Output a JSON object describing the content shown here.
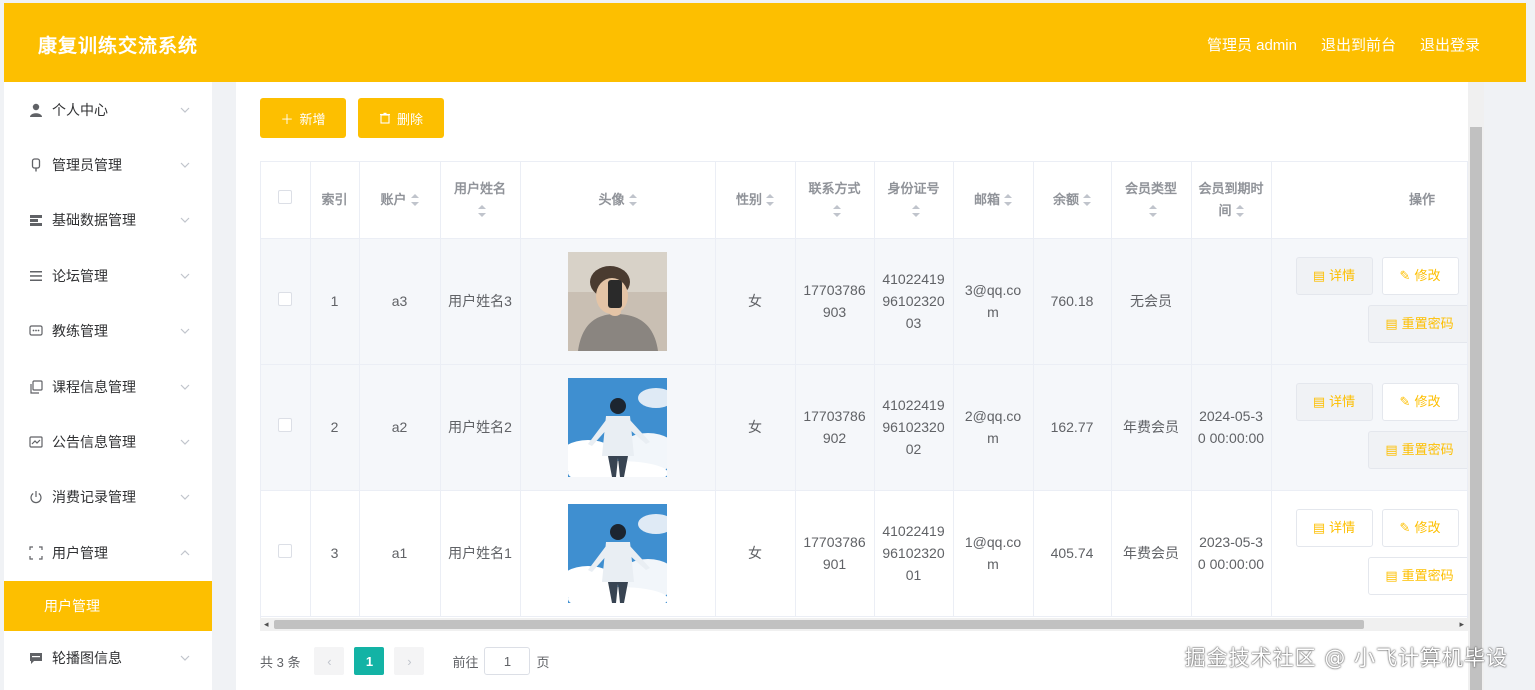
{
  "app": {
    "title": "康复训练交流系统"
  },
  "topnav": {
    "user": "管理员 admin",
    "front": "退出到前台",
    "logout": "退出登录"
  },
  "sidebar": {
    "items": [
      {
        "label": "个人中心",
        "icon": "user-icon",
        "expanded": false
      },
      {
        "label": "管理员管理",
        "icon": "lock-icon",
        "expanded": false
      },
      {
        "label": "基础数据管理",
        "icon": "database-icon",
        "expanded": false
      },
      {
        "label": "论坛管理",
        "icon": "list-icon",
        "expanded": false
      },
      {
        "label": "教练管理",
        "icon": "chat-icon",
        "expanded": false
      },
      {
        "label": "课程信息管理",
        "icon": "copy-icon",
        "expanded": false
      },
      {
        "label": "公告信息管理",
        "icon": "chart-icon",
        "expanded": false
      },
      {
        "label": "消费记录管理",
        "icon": "power-icon",
        "expanded": false
      },
      {
        "label": "用户管理",
        "icon": "fullscreen-icon",
        "expanded": true
      },
      {
        "label": "轮播图信息",
        "icon": "message-icon",
        "expanded": false
      }
    ],
    "active_sub": "用户管理"
  },
  "toolbar": {
    "add_label": "新增",
    "delete_label": "删除"
  },
  "table": {
    "headers": {
      "index": "索引",
      "account": "账户",
      "name": "用户姓名",
      "avatar": "头像",
      "gender": "性别",
      "phone": "联系方式",
      "idcard": "身份证号",
      "email": "邮箱",
      "balance": "余额",
      "member_type": "会员类型",
      "expire": "会员到期时间",
      "ops": "操作"
    },
    "rows": [
      {
        "index": "1",
        "account": "a3",
        "name": "用户姓名3",
        "avatar": "photo-selfie",
        "gender": "女",
        "phone": "17703786903",
        "idcard": "410224199610232003",
        "email": "3@qq.com",
        "balance": "760.18",
        "member_type": "无会员",
        "expire": ""
      },
      {
        "index": "2",
        "account": "a2",
        "name": "用户姓名2",
        "avatar": "photo-sky",
        "gender": "女",
        "phone": "17703786902",
        "idcard": "410224199610232002",
        "email": "2@qq.com",
        "balance": "162.77",
        "member_type": "年费会员",
        "expire": "2024-05-30 00:00:00"
      },
      {
        "index": "3",
        "account": "a1",
        "name": "用户姓名1",
        "avatar": "photo-sky",
        "gender": "女",
        "phone": "17703786901",
        "idcard": "410224199610232001",
        "email": "1@qq.com",
        "balance": "405.74",
        "member_type": "年费会员",
        "expire": "2023-05-30 00:00:00"
      }
    ],
    "actions": {
      "detail": "详情",
      "edit": "修改",
      "reset": "重置密码"
    }
  },
  "pager": {
    "total": "共 3 条",
    "current": "1",
    "goto_prefix": "前往",
    "goto_value": "1",
    "goto_suffix": "页"
  },
  "colors": {
    "accent": "#fdbf00",
    "page_active": "#13b3a5"
  },
  "watermark": "掘金技术社区 @ 小飞计算机毕设"
}
